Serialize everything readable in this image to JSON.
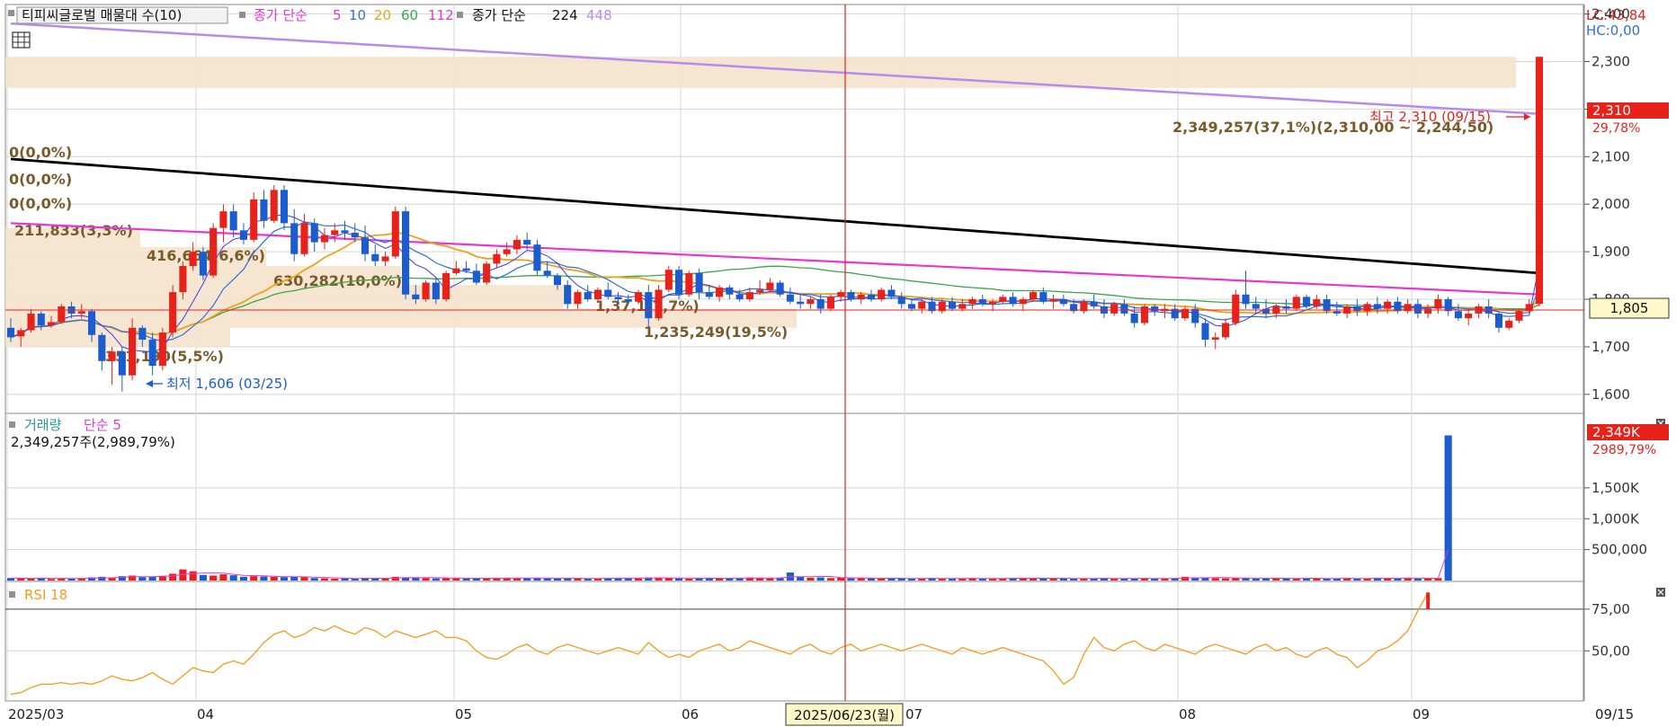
{
  "colors": {
    "up": "#e8221b",
    "down": "#1b5ccf",
    "ma5": "#3a3af0",
    "ma10": "#2f6fd8",
    "ma20": "#e8a41c",
    "ma60": "#3aa64a",
    "ma112": "#e637d2",
    "ma224": "#000000",
    "ma448": "#b889f0",
    "grid": "#d4d4d4",
    "band": "#f5e3cc",
    "bandText": "#7a5a2a",
    "rsi": "#f29b1e",
    "crosshair": "#e8221b"
  },
  "header": {
    "stock_name": "티피씨글로벌 매물대 수(10)",
    "ma_prefix": "종가 단순",
    "ma_periods": [
      "5",
      "10",
      "20",
      "60",
      "112"
    ],
    "ma_long_prefix": "종가 단순",
    "ma_long_periods": [
      "224",
      "448"
    ],
    "lc_text": "LC:43,84",
    "hc_text": "HC:0,00"
  },
  "volume_header": {
    "title": "거래량",
    "ma": "단순 5",
    "summary": "2,349,257주(2,989,79%)"
  },
  "rsi_header": {
    "title": "RSI 18"
  },
  "price_axis": {
    "ticks": [
      "2,400",
      "2,300",
      "2,200",
      "2,100",
      "2,000",
      "1,900",
      "1,800",
      "1,700",
      "1,600"
    ],
    "current_price": "1,805",
    "last_tag": "2,310",
    "last_pct": "29,78%"
  },
  "volume_axis": {
    "ticks": [
      "1,500K",
      "1,000K",
      "500,000"
    ],
    "tag": "2,349K",
    "tag_pct": "2989,79%"
  },
  "rsi_axis": {
    "ticks": [
      "75,00",
      "50,00"
    ]
  },
  "x_axis": {
    "labels": [
      "2025/03",
      "04",
      "05",
      "06",
      "07",
      "08",
      "09"
    ],
    "crosshair_date": "2025/06/23(월)",
    "end_label": "09/15"
  },
  "annotations": {
    "high": "최고 2,310 (09/15)",
    "low": "최저 1,606 (03/25)",
    "bands": [
      "0(0,0%)",
      "0(0,0%)",
      "0(0,0%)",
      "211,833(3,3%)",
      "416,664(6,6%)",
      "630,282(10,0%)",
      "351,190(5,5%)",
      "2,349,257(37,1%)(2,310,00 ~ 2,244,50)",
      "1,235,249(19,5%)",
      "1,37,1(7,7%)"
    ]
  },
  "chart_data": {
    "type": "candlestick",
    "start_date": "2025-03-04",
    "end_date": "2025-09-15",
    "price_range": [
      1560,
      2420
    ],
    "candles": [
      [
        1740,
        1760,
        1710,
        1720
      ],
      [
        1722,
        1740,
        1700,
        1735
      ],
      [
        1735,
        1780,
        1730,
        1770
      ],
      [
        1770,
        1775,
        1735,
        1745
      ],
      [
        1745,
        1765,
        1740,
        1752
      ],
      [
        1752,
        1790,
        1748,
        1785
      ],
      [
        1785,
        1795,
        1760,
        1770
      ],
      [
        1770,
        1790,
        1760,
        1775
      ],
      [
        1775,
        1780,
        1710,
        1725
      ],
      [
        1725,
        1730,
        1650,
        1670
      ],
      [
        1670,
        1700,
        1620,
        1690
      ],
      [
        1690,
        1700,
        1606,
        1640
      ],
      [
        1640,
        1760,
        1630,
        1740
      ],
      [
        1740,
        1745,
        1700,
        1715
      ],
      [
        1715,
        1730,
        1640,
        1660
      ],
      [
        1660,
        1740,
        1650,
        1730
      ],
      [
        1730,
        1830,
        1720,
        1815
      ],
      [
        1815,
        1880,
        1800,
        1870
      ],
      [
        1870,
        1920,
        1860,
        1900
      ],
      [
        1900,
        1910,
        1840,
        1850
      ],
      [
        1850,
        1960,
        1845,
        1950
      ],
      [
        1950,
        2000,
        1920,
        1985
      ],
      [
        1985,
        2000,
        1930,
        1945
      ],
      [
        1945,
        1960,
        1915,
        1925
      ],
      [
        1925,
        2025,
        1920,
        2010
      ],
      [
        2010,
        2030,
        1950,
        1965
      ],
      [
        1965,
        2040,
        1960,
        2030
      ],
      [
        2030,
        2040,
        1945,
        1960
      ],
      [
        1960,
        1990,
        1880,
        1895
      ],
      [
        1895,
        1980,
        1890,
        1960
      ],
      [
        1960,
        1970,
        1900,
        1920
      ],
      [
        1920,
        1950,
        1905,
        1935
      ],
      [
        1935,
        1960,
        1920,
        1945
      ],
      [
        1945,
        1965,
        1925,
        1940
      ],
      [
        1940,
        1960,
        1920,
        1930
      ],
      [
        1930,
        1955,
        1880,
        1895
      ],
      [
        1895,
        1915,
        1870,
        1880
      ],
      [
        1880,
        1900,
        1870,
        1890
      ],
      [
        1890,
        1995,
        1885,
        1985
      ],
      [
        1985,
        1995,
        1800,
        1810
      ],
      [
        1810,
        1830,
        1790,
        1800
      ],
      [
        1800,
        1840,
        1795,
        1835
      ],
      [
        1835,
        1845,
        1790,
        1800
      ],
      [
        1800,
        1860,
        1795,
        1855
      ],
      [
        1855,
        1880,
        1850,
        1865
      ],
      [
        1865,
        1880,
        1855,
        1860
      ],
      [
        1860,
        1875,
        1830,
        1835
      ],
      [
        1835,
        1880,
        1830,
        1875
      ],
      [
        1875,
        1905,
        1865,
        1895
      ],
      [
        1895,
        1920,
        1890,
        1905
      ],
      [
        1905,
        1935,
        1895,
        1925
      ],
      [
        1925,
        1940,
        1905,
        1915
      ],
      [
        1915,
        1925,
        1850,
        1860
      ],
      [
        1860,
        1880,
        1845,
        1850
      ],
      [
        1850,
        1855,
        1820,
        1830
      ],
      [
        1830,
        1840,
        1780,
        1790
      ],
      [
        1790,
        1820,
        1780,
        1815
      ],
      [
        1815,
        1830,
        1795,
        1800
      ],
      [
        1800,
        1825,
        1795,
        1820
      ],
      [
        1820,
        1835,
        1800,
        1805
      ],
      [
        1805,
        1815,
        1790,
        1800
      ],
      [
        1800,
        1810,
        1790,
        1795
      ],
      [
        1795,
        1820,
        1790,
        1815
      ],
      [
        1815,
        1830,
        1740,
        1760
      ],
      [
        1760,
        1830,
        1755,
        1820
      ],
      [
        1820,
        1870,
        1815,
        1862
      ],
      [
        1862,
        1870,
        1800,
        1810
      ],
      [
        1810,
        1860,
        1805,
        1855
      ],
      [
        1855,
        1865,
        1800,
        1815
      ],
      [
        1815,
        1830,
        1800,
        1805
      ],
      [
        1805,
        1830,
        1795,
        1825
      ],
      [
        1825,
        1830,
        1800,
        1810
      ],
      [
        1810,
        1820,
        1795,
        1800
      ],
      [
        1800,
        1825,
        1795,
        1815
      ],
      [
        1815,
        1840,
        1810,
        1820
      ],
      [
        1820,
        1845,
        1815,
        1835
      ],
      [
        1835,
        1840,
        1805,
        1810
      ],
      [
        1810,
        1825,
        1790,
        1795
      ],
      [
        1795,
        1810,
        1780,
        1790
      ],
      [
        1790,
        1805,
        1780,
        1800
      ],
      [
        1800,
        1810,
        1770,
        1780
      ],
      [
        1780,
        1810,
        1775,
        1805
      ],
      [
        1805,
        1820,
        1795,
        1815
      ],
      [
        1815,
        1820,
        1795,
        1800
      ],
      [
        1800,
        1815,
        1790,
        1810
      ],
      [
        1810,
        1820,
        1795,
        1800
      ],
      [
        1800,
        1825,
        1795,
        1820
      ],
      [
        1820,
        1830,
        1800,
        1805
      ],
      [
        1805,
        1815,
        1780,
        1790
      ],
      [
        1790,
        1800,
        1775,
        1780
      ],
      [
        1780,
        1800,
        1770,
        1795
      ],
      [
        1795,
        1805,
        1770,
        1775
      ],
      [
        1775,
        1800,
        1770,
        1795
      ],
      [
        1795,
        1805,
        1775,
        1780
      ],
      [
        1780,
        1800,
        1775,
        1790
      ],
      [
        1790,
        1805,
        1780,
        1800
      ],
      [
        1800,
        1810,
        1785,
        1790
      ],
      [
        1790,
        1800,
        1775,
        1795
      ],
      [
        1795,
        1810,
        1790,
        1805
      ],
      [
        1805,
        1815,
        1785,
        1790
      ],
      [
        1790,
        1805,
        1775,
        1800
      ],
      [
        1800,
        1820,
        1795,
        1815
      ],
      [
        1815,
        1825,
        1790,
        1795
      ],
      [
        1795,
        1810,
        1780,
        1800
      ],
      [
        1800,
        1810,
        1785,
        1790
      ],
      [
        1790,
        1800,
        1770,
        1775
      ],
      [
        1775,
        1800,
        1770,
        1795
      ],
      [
        1795,
        1810,
        1780,
        1785
      ],
      [
        1785,
        1800,
        1760,
        1770
      ],
      [
        1770,
        1795,
        1765,
        1790
      ],
      [
        1790,
        1800,
        1765,
        1770
      ],
      [
        1770,
        1785,
        1740,
        1750
      ],
      [
        1750,
        1790,
        1745,
        1785
      ],
      [
        1785,
        1790,
        1765,
        1775
      ],
      [
        1775,
        1790,
        1760,
        1780
      ],
      [
        1780,
        1790,
        1755,
        1760
      ],
      [
        1760,
        1785,
        1755,
        1780
      ],
      [
        1780,
        1790,
        1740,
        1750
      ],
      [
        1750,
        1760,
        1700,
        1715
      ],
      [
        1715,
        1730,
        1695,
        1720
      ],
      [
        1720,
        1760,
        1715,
        1750
      ],
      [
        1750,
        1820,
        1745,
        1810
      ],
      [
        1810,
        1860,
        1780,
        1790
      ],
      [
        1790,
        1805,
        1770,
        1780
      ],
      [
        1780,
        1800,
        1760,
        1770
      ],
      [
        1770,
        1790,
        1760,
        1785
      ],
      [
        1785,
        1800,
        1770,
        1780
      ],
      [
        1780,
        1810,
        1775,
        1805
      ],
      [
        1805,
        1810,
        1780,
        1785
      ],
      [
        1785,
        1810,
        1780,
        1800
      ],
      [
        1800,
        1810,
        1770,
        1775
      ],
      [
        1775,
        1795,
        1765,
        1770
      ],
      [
        1770,
        1790,
        1760,
        1785
      ],
      [
        1785,
        1800,
        1765,
        1775
      ],
      [
        1775,
        1795,
        1765,
        1790
      ],
      [
        1790,
        1805,
        1770,
        1780
      ],
      [
        1780,
        1800,
        1770,
        1795
      ],
      [
        1795,
        1805,
        1770,
        1775
      ],
      [
        1775,
        1800,
        1770,
        1790
      ],
      [
        1790,
        1800,
        1760,
        1770
      ],
      [
        1770,
        1790,
        1760,
        1780
      ],
      [
        1780,
        1810,
        1770,
        1800
      ],
      [
        1800,
        1805,
        1765,
        1775
      ],
      [
        1775,
        1790,
        1755,
        1760
      ],
      [
        1760,
        1780,
        1745,
        1770
      ],
      [
        1770,
        1790,
        1760,
        1785
      ],
      [
        1785,
        1800,
        1760,
        1770
      ],
      [
        1770,
        1775,
        1730,
        1740
      ],
      [
        1740,
        1760,
        1735,
        1755
      ],
      [
        1755,
        1780,
        1750,
        1775
      ],
      [
        1775,
        1800,
        1770,
        1790
      ],
      [
        1790,
        2310,
        1785,
        2310
      ]
    ],
    "volume_k": [
      40,
      35,
      30,
      45,
      25,
      40,
      30,
      35,
      50,
      60,
      45,
      70,
      80,
      55,
      60,
      75,
      110,
      180,
      150,
      90,
      80,
      100,
      85,
      60,
      70,
      65,
      60,
      55,
      60,
      55,
      40,
      35,
      30,
      35,
      30,
      45,
      40,
      35,
      60,
      50,
      45,
      40,
      35,
      40,
      35,
      30,
      40,
      35,
      45,
      40,
      35,
      40,
      45,
      35,
      30,
      40,
      35,
      30,
      35,
      40,
      45,
      40,
      35,
      50,
      45,
      40,
      35,
      30,
      40,
      45,
      35,
      30,
      40,
      50,
      45,
      35,
      40,
      130,
      60,
      45,
      50,
      40,
      45,
      35,
      40,
      35,
      30,
      40,
      35,
      30,
      35,
      40,
      30,
      35,
      30,
      40,
      35,
      30,
      35,
      40,
      45,
      30,
      35,
      30,
      40,
      35,
      30,
      35,
      40,
      30,
      35,
      30,
      40,
      35,
      30,
      40,
      60,
      50,
      45,
      40,
      35,
      40,
      45,
      30,
      35,
      40,
      35,
      30,
      40,
      35,
      30,
      35,
      40,
      30,
      35,
      45,
      40,
      35,
      40,
      30,
      35,
      40,
      2349
    ],
    "rsi": [
      24,
      25,
      28,
      30,
      30,
      31,
      30,
      31,
      30,
      32,
      35,
      33,
      32,
      34,
      37,
      33,
      30,
      35,
      40,
      38,
      37,
      42,
      44,
      42,
      48,
      55,
      60,
      62,
      58,
      60,
      64,
      62,
      65,
      62,
      60,
      64,
      62,
      58,
      62,
      60,
      58,
      60,
      62,
      58,
      58,
      56,
      50,
      46,
      45,
      48,
      52,
      54,
      50,
      48,
      52,
      54,
      52,
      50,
      48,
      50,
      52,
      50,
      48,
      55,
      50,
      46,
      48,
      46,
      50,
      52,
      54,
      50,
      52,
      56,
      54,
      52,
      50,
      48,
      52,
      54,
      50,
      48,
      52,
      54,
      50,
      52,
      54,
      52,
      50,
      52,
      54,
      52,
      50,
      48,
      52,
      50,
      48,
      50,
      52,
      50,
      48,
      46,
      44,
      38,
      30,
      34,
      48,
      58,
      52,
      50,
      54,
      56,
      52,
      50,
      54,
      52,
      50,
      48,
      52,
      54,
      52,
      50,
      48,
      52,
      54,
      50,
      52,
      48,
      46,
      50,
      52,
      48,
      46,
      40,
      44,
      50,
      52,
      56,
      62,
      74,
      85
    ]
  }
}
